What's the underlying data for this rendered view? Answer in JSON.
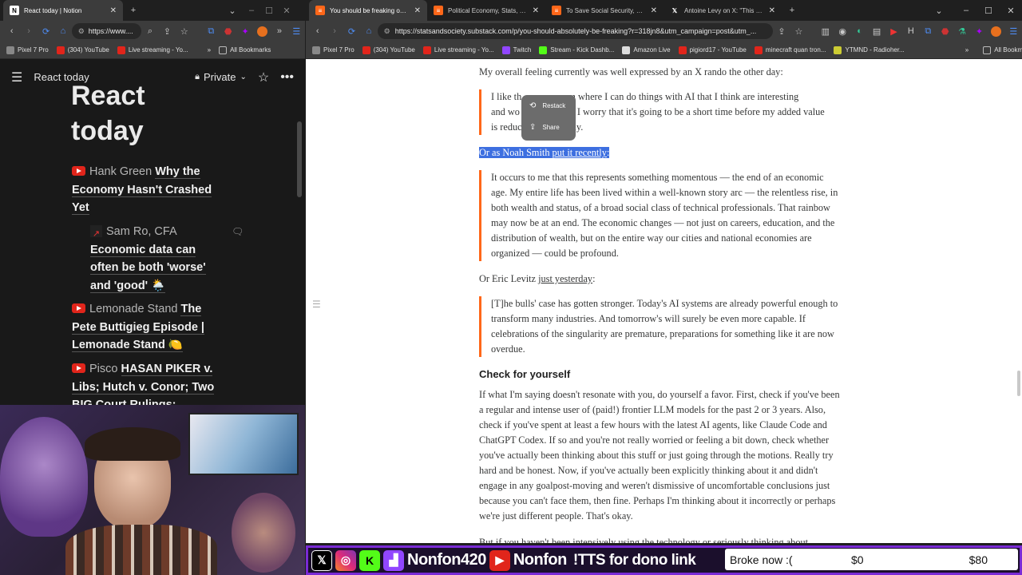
{
  "left_window": {
    "tabs": [
      {
        "title": "React today | Notion",
        "active": true
      }
    ],
    "url": "https://www....",
    "bookmarks": [
      "Pixel 7 Pro",
      "(304) YouTube",
      "Live streaming - Yo..."
    ],
    "all_bookmarks": "All Bookmarks"
  },
  "right_window": {
    "tabs": [
      {
        "title": "You should be freaking out ab",
        "active": true
      },
      {
        "title": "Political Economy, Stats, and S",
        "active": false
      },
      {
        "title": "To Save Social Security, Stop S",
        "active": false
      },
      {
        "title": "Antoine Levy on X: \"This graph",
        "active": false
      }
    ],
    "url": "https://statsandsociety.substack.com/p/you-should-absolutely-be-freaking?r=318jn8&utm_campaign=post&utm_...",
    "bookmarks": [
      "Pixel 7 Pro",
      "(304) YouTube",
      "Live streaming - Yo...",
      "Twitch",
      "Stream - Kick Dashb...",
      "Amazon Live",
      "pigiord17 - YouTube",
      "minecraft quan tron...",
      "YTMND - Radioher..."
    ],
    "all_bookmarks": "All Bookmarks"
  },
  "notion": {
    "page_name": "React today",
    "privacy": "Private",
    "heading_line1": "React",
    "heading_line2": "today",
    "items": [
      {
        "channel": "Hank Green",
        "title": "Why the Economy Hasn't Crashed Yet"
      },
      {
        "channel": "Sam Ro, CFA",
        "title": "Economic data can often be both 'worse' and 'good' 🌦️"
      },
      {
        "channel": "Lemonade Stand",
        "title": "The Pete Buttigieg Episode | Lemonade Stand 🍋"
      },
      {
        "channel": "Pisco",
        "title": "HASAN PIKER v. Libs; Hutch v. Conor; Two BIG Court Rulings;"
      }
    ]
  },
  "article": {
    "p1": "My overall feeling currently was well expressed by an X rando the other day:",
    "q1": "I like th... um where I can do things with AI that I think are interesting and wo... I worry that it's going to be a short time before my added value is reduc... ally.",
    "q1_line1": "I like th",
    "q1_line1b": "um where I can do things with AI that I think are interesting",
    "q1_line2": "and wo",
    "q1_line2b": "I worry that it's going to be a short time before my added value",
    "q1_line3": "is reduc",
    "q1_line3b": "ally.",
    "hl_prefix": "Or as Noah Smith ",
    "hl_link": "put it recently",
    "hl_suffix": ":",
    "q2": "It occurs to me that this represents something momentous — the end of an economic age. My entire life has been lived within a well-known story arc — the relentless rise, in both wealth and status, of a broad social class of technical professionals. That rainbow may now be at an end. The economic changes — not just on careers, education, and the distribution of wealth, but on the entire way our cities and national economies are organized — could be profound.",
    "p2_prefix": "Or Eric Levitz ",
    "p2_link": "just yesterday",
    "p2_suffix": ":",
    "q3": "[T]he bulls' case has gotten stronger. Today's AI systems are already powerful enough to transform many industries. And tomorrow's will surely be even more capable. If celebrations of the singularity are premature, preparations for something like it are now overdue.",
    "section_heading": "Check for yourself",
    "p3": "If what I'm saying doesn't resonate with you, do yourself a favor. First, check if you've been a regular and intense user of (paid!) frontier LLM models for the past 2 or 3 years. Also, check if you've spent at least a few hours with the latest AI agents, like Claude Code and ChatGPT Codex. If so and you're not really worried or feeling a bit down, check whether you've actually been thinking about this stuff or just going through the motions. Really try hard and be honest. Now, if you've actually been explicitly thinking about it and didn't engage in any goalpost-moving and weren't dismissive of uncomfortable conclusions just because you can't face them, then fine. Perhaps I'm thinking about it incorrectly or perhaps we're just different people. That's okay.",
    "p4": "But if you haven't been intensively using the technology or seriously thinking about",
    "popup": {
      "restack": "Restack",
      "share": "Share"
    }
  },
  "overlay": {
    "handle": "Nonfon420",
    "yt_handle": "Nonfon",
    "tts": "!TTS for dono link",
    "goal_label": "Broke now :(",
    "goal_current": "$0",
    "goal_target": "$80",
    "colors": {
      "frame": "#7a2bd6",
      "bg": "#1b0f2c"
    }
  }
}
